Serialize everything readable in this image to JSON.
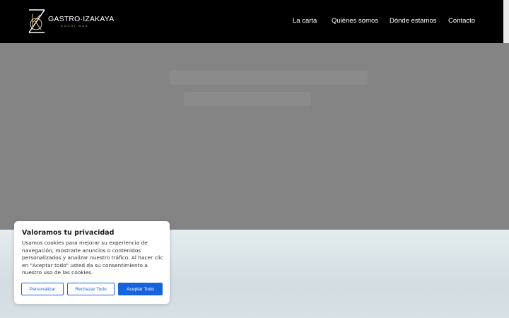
{
  "header": {
    "logo_text": "GASTRO·IZAKAYA",
    "logo_subtext": "SUSHI BAR",
    "logo_icon": "kz-monogram-icon",
    "nav": [
      {
        "label": "La carta"
      },
      {
        "label": "Quiénes somos"
      },
      {
        "label": "Dónde estamos"
      },
      {
        "label": "Contacto"
      }
    ]
  },
  "cookie_banner": {
    "title": "Valoramos tu privacidad",
    "body": "Usamos cookies para mejorar su experiencia de navegación, mostrarle anuncios o contenidos personalizados y analizar nuestro tráfico. Al hacer clic en \"Aceptar todo\" usted da su consentimiento a nuestro uso de las cookies.",
    "buttons": {
      "customize": "Personalizar",
      "reject": "Rechazar Todo",
      "accept": "Aceptar Todo"
    }
  },
  "colors": {
    "header_bg": "#000000",
    "hero_overlay": "#848484",
    "accent": "#1863dc",
    "logo_gold": "#c8a86a"
  }
}
